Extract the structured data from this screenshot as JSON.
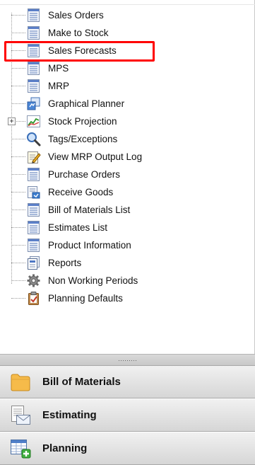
{
  "tree": {
    "items": [
      {
        "label": "Sales Orders",
        "icon": "list-icon"
      },
      {
        "label": "Make to Stock",
        "icon": "list-icon"
      },
      {
        "label": "Sales Forecasts",
        "icon": "list-icon"
      },
      {
        "label": "MPS",
        "icon": "list-icon"
      },
      {
        "label": "MRP",
        "icon": "list-icon"
      },
      {
        "label": "Graphical Planner",
        "icon": "planner-icon"
      },
      {
        "label": "Stock Projection",
        "icon": "chart-icon",
        "expander": "+"
      },
      {
        "label": "Tags/Exceptions",
        "icon": "magnifier-icon"
      },
      {
        "label": "View MRP Output Log",
        "icon": "log-pencil-icon"
      },
      {
        "label": "Purchase Orders",
        "icon": "list-icon"
      },
      {
        "label": "Receive Goods",
        "icon": "receive-icon"
      },
      {
        "label": "Bill of Materials List",
        "icon": "list-icon"
      },
      {
        "label": "Estimates List",
        "icon": "list-icon"
      },
      {
        "label": "Product Information",
        "icon": "list-icon"
      },
      {
        "label": "Reports",
        "icon": "reports-icon"
      },
      {
        "label": "Non Working Periods",
        "icon": "gear-icon"
      },
      {
        "label": "Planning Defaults",
        "icon": "clipboard-check-icon"
      }
    ],
    "highlighted": "Sales Forecasts",
    "highlight_color": "#ff0000"
  },
  "splitter": {
    "grip": "·········"
  },
  "sections": [
    {
      "label": "Bill of Materials",
      "icon": "folder-icon"
    },
    {
      "label": "Estimating",
      "icon": "estimating-icon"
    },
    {
      "label": "Planning",
      "icon": "planning-icon"
    }
  ]
}
